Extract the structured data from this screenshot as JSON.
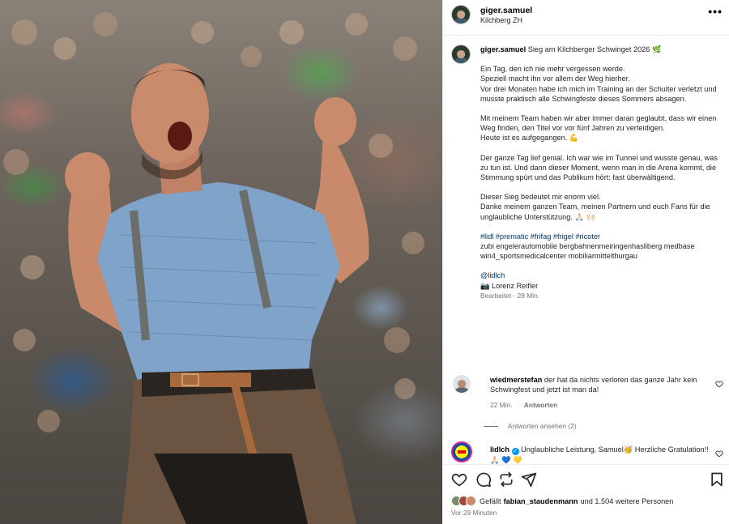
{
  "post": {
    "author": "giger.samuel",
    "location": "Kilchberg ZH",
    "more_label": "•••"
  },
  "caption": {
    "author": "giger.samuel",
    "headline": "Sieg am Kilchberger Schwinget 2026 🌿",
    "lines_1": [
      "Ein Tag, den ich nie mehr vergessen werde.",
      "Speziell macht ihn vor allem der Weg hierher.",
      "Vor drei Monaten habe ich mich im Training an der Schulter verletzt und musste praktisch alle Schwingfeste dieses Sommers absagen."
    ],
    "lines_2": [
      "Mit meinem Team haben wir aber immer daran geglaubt, dass wir einen Weg finden, den Titel vor vor fünf Jahren zu verteidigen.",
      "Heute ist es aufgegangen. 💪"
    ],
    "lines_3": [
      "Der ganze Tag lief genial. Ich war wie im Tunnel und wusste genau, was zu tun ist. Und dann dieser Moment, wenn man in die Arena kommt, die Stimmung spürt und das Publikum hört: fast überwältigend."
    ],
    "lines_4": [
      "Dieser Sieg bedeutet mir enorm viel.",
      "Danke meinem ganzen Team, meinen Partnern und euch Fans für die unglaubliche Unterstützung. 🙏🏻 🙌🏻"
    ],
    "hashtags": "#lidl #prematic #frifag #frigel #ricoter",
    "sponsors": "zubi engelerautomobile bergbahnenmeiringenhasliberg medbase win4_sportsmedicalcenter mobiliarmittelthurgau",
    "mention": "@lidlch",
    "credit_icon": "camera-emoji",
    "credit": "📷 Lorenz Reifler",
    "edited": "Bearbeitet · 28 Min."
  },
  "comments": [
    {
      "user": "wiedmerstefan",
      "text": "der hat da nichts verloren das ganze Jahr kein Schwingfest und jetzt ist man da!",
      "time": "22 Min.",
      "reply_label": "Antworten"
    },
    {
      "user": "lidlch",
      "text": "Unglaubliche Leistung, Samuel🥳 Herzliche Gratulation!! 🙏🏻 💙 💛",
      "verified": true
    }
  ],
  "replies_label": "Antworten ansehen (2)",
  "likes": {
    "prefix": "Gefällt",
    "user": "fabian_staudenmann",
    "suffix": "und 1.504 weitere Personen"
  },
  "timestamp": "Vor 29 Minuten",
  "colors": {
    "link": "#00376b",
    "meta": "#737373",
    "verified": "#0095f6",
    "lidl_yellow": "#fff000",
    "lidl_blue": "#0050aa",
    "lidl_red": "#e60a14"
  }
}
